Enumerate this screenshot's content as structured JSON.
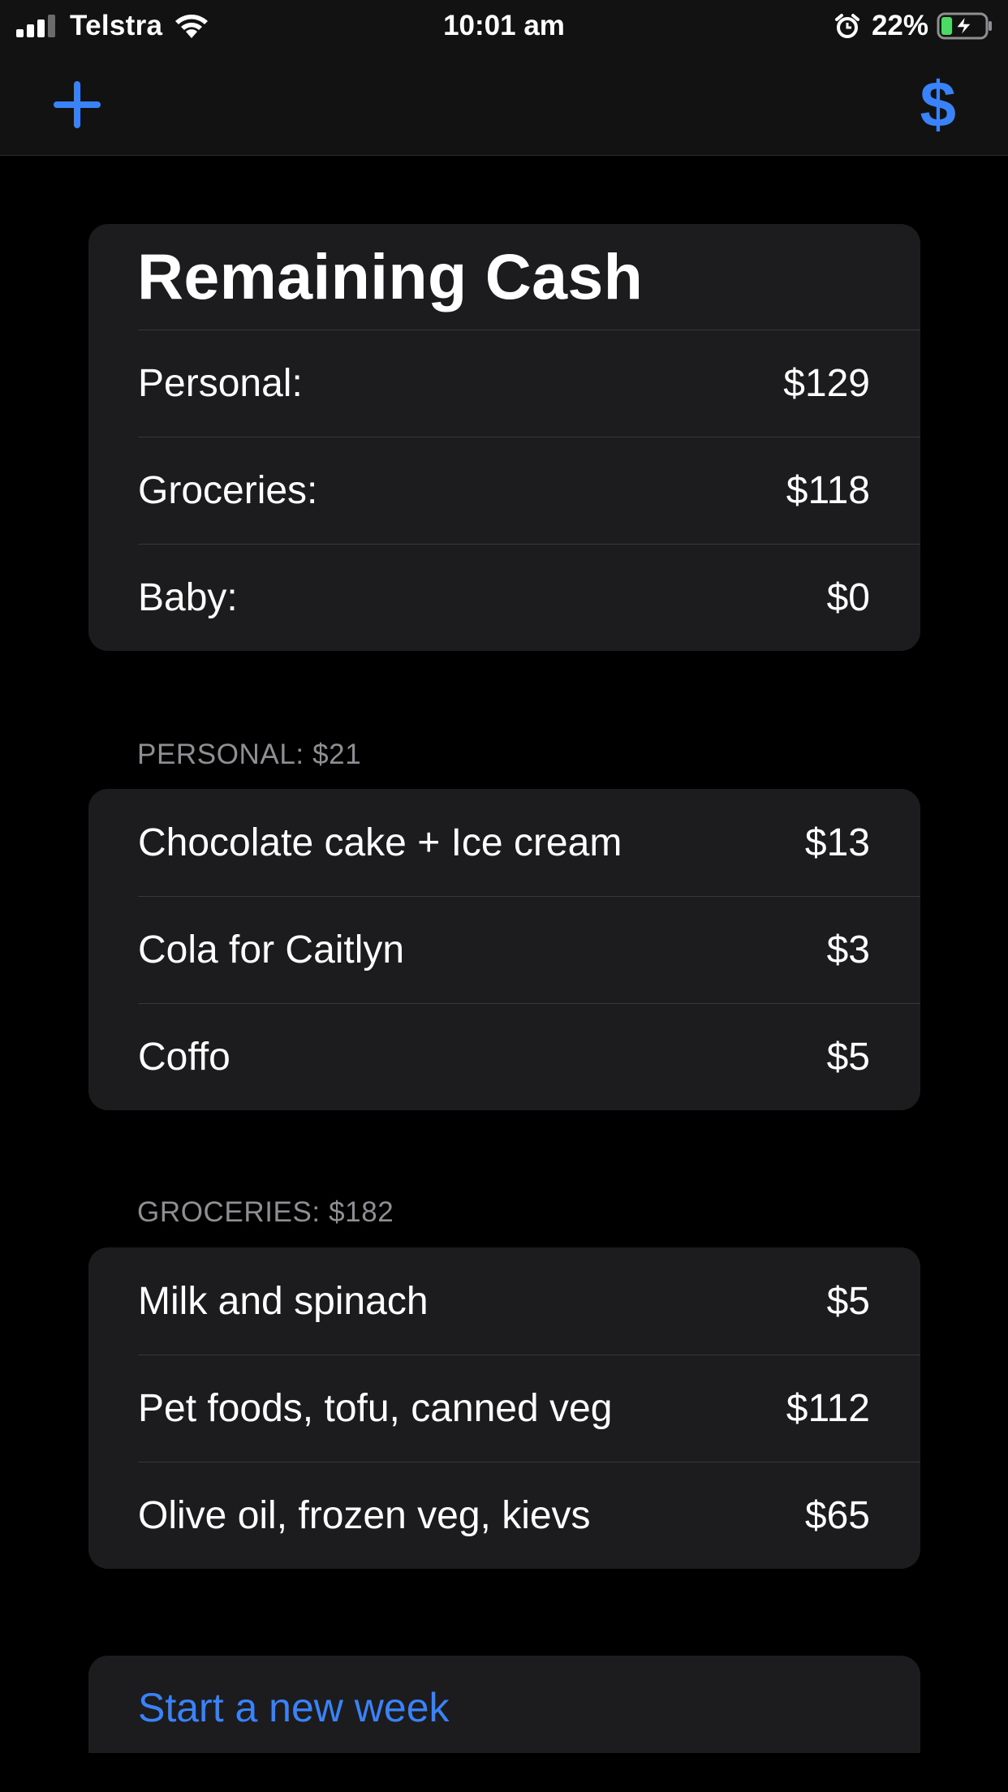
{
  "status_bar": {
    "carrier": "Telstra",
    "time": "10:01 am",
    "battery_percent": "22%",
    "signal_icon": "cellular-signal-icon",
    "wifi_icon": "wifi-icon",
    "alarm_icon": "alarm-icon",
    "battery_icon": "battery-charging-icon"
  },
  "nav": {
    "add_icon": "plus-icon",
    "dollar_label": "$"
  },
  "summary": {
    "title": "Remaining Cash",
    "rows": [
      {
        "label": "Personal:",
        "amount": "$129"
      },
      {
        "label": "Groceries:",
        "amount": "$118"
      },
      {
        "label": "Baby:",
        "amount": "$0"
      }
    ]
  },
  "sections": [
    {
      "header": "PERSONAL: $21",
      "items": [
        {
          "label": "Chocolate cake + Ice cream",
          "amount": "$13"
        },
        {
          "label": "Cola for Caitlyn",
          "amount": "$3"
        },
        {
          "label": "Coffo",
          "amount": "$5"
        }
      ]
    },
    {
      "header": "GROCERIES: $182",
      "items": [
        {
          "label": "Milk and spinach",
          "amount": "$5"
        },
        {
          "label": "Pet foods, tofu, canned veg",
          "amount": "$112"
        },
        {
          "label": "Olive oil, frozen veg, kievs",
          "amount": "$65"
        }
      ]
    }
  ],
  "actions": {
    "new_week_label": "Start a new week"
  },
  "colors": {
    "accent": "#3a82f7",
    "card": "#1c1c1e",
    "background": "#000000",
    "battery_fill": "#4cd964"
  }
}
